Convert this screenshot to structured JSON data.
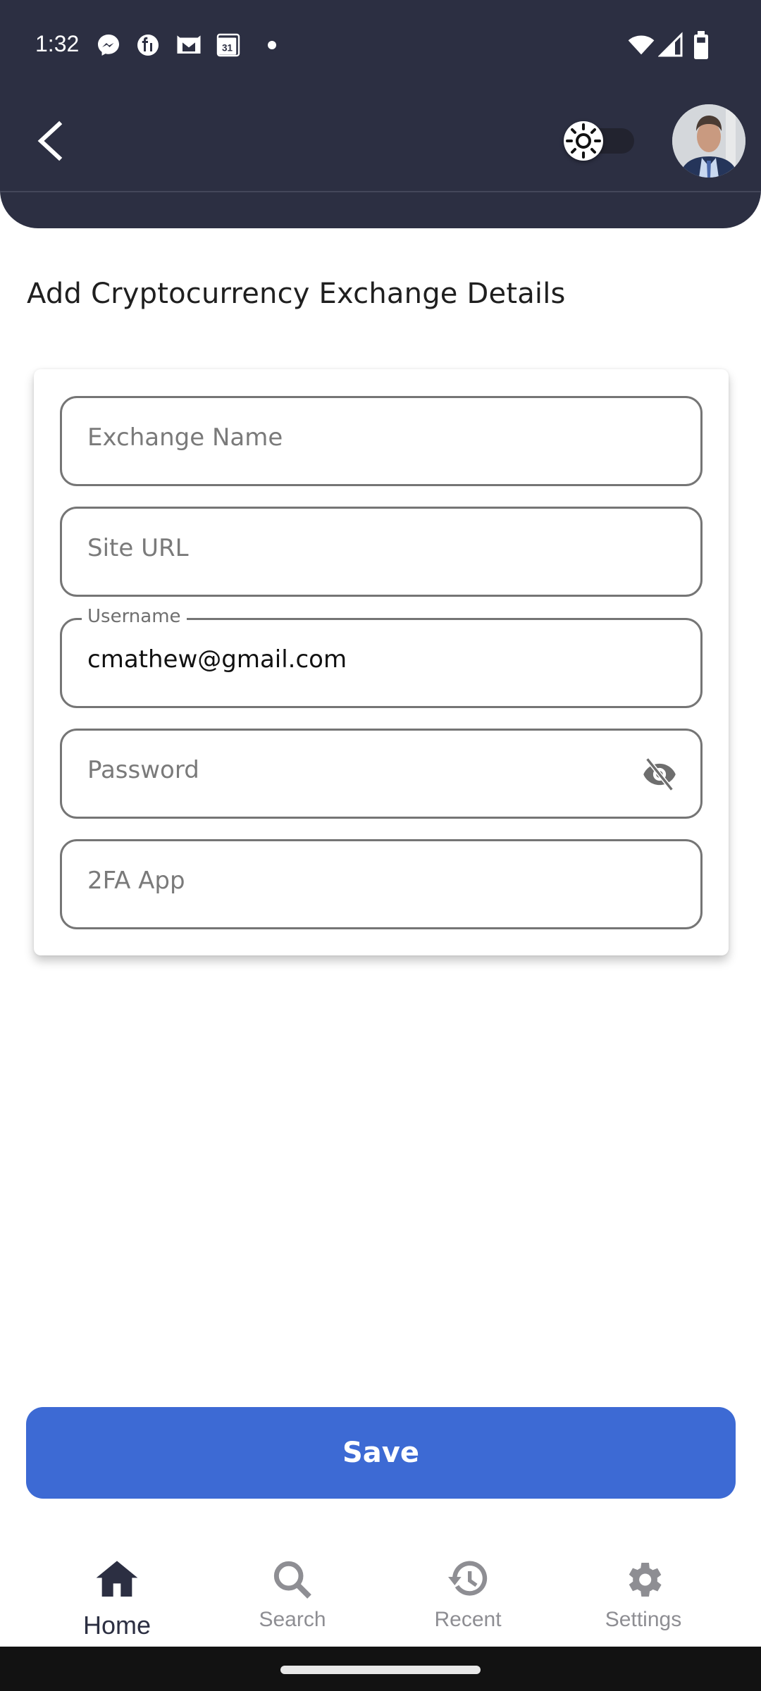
{
  "status_bar": {
    "time": "1:32",
    "notification_icons": [
      "messenger-icon",
      "fi-app-icon",
      "gmail-icon",
      "calendar-icon",
      "more-dot-icon"
    ],
    "calendar_day": "31",
    "system_icons": [
      "wifi-icon",
      "cellular-signal-icon",
      "battery-icon"
    ]
  },
  "app_bar": {
    "back_icon": "chevron-left-icon",
    "theme_toggle": {
      "icon": "sun-icon",
      "state": "light"
    },
    "avatar_alt": "user avatar"
  },
  "page": {
    "title": "Add Cryptocurrency Exchange Details"
  },
  "form": {
    "fields": [
      {
        "name": "exchange-name",
        "placeholder": "Exchange Name",
        "value": ""
      },
      {
        "name": "site-url",
        "placeholder": "Site URL",
        "value": ""
      },
      {
        "name": "username",
        "label": "Username",
        "value": "cmathew@gmail.com"
      },
      {
        "name": "password",
        "placeholder": "Password",
        "value": "",
        "trailing_icon": "eye-off-icon"
      },
      {
        "name": "two-fa-app",
        "placeholder": "2FA App",
        "value": ""
      }
    ],
    "save_label": "Save"
  },
  "bottom_nav": {
    "items": [
      {
        "label": "Home",
        "icon": "home-icon",
        "active": true
      },
      {
        "label": "Search",
        "icon": "search-icon",
        "active": false
      },
      {
        "label": "Recent",
        "icon": "history-icon",
        "active": false
      },
      {
        "label": "Settings",
        "icon": "gear-icon",
        "active": false
      }
    ]
  },
  "colors": {
    "header_bg": "#2c2f42",
    "primary": "#3d6ad4",
    "nav_active": "#2c2f42",
    "nav_inactive": "#8e8e93",
    "field_border": "#757575"
  }
}
